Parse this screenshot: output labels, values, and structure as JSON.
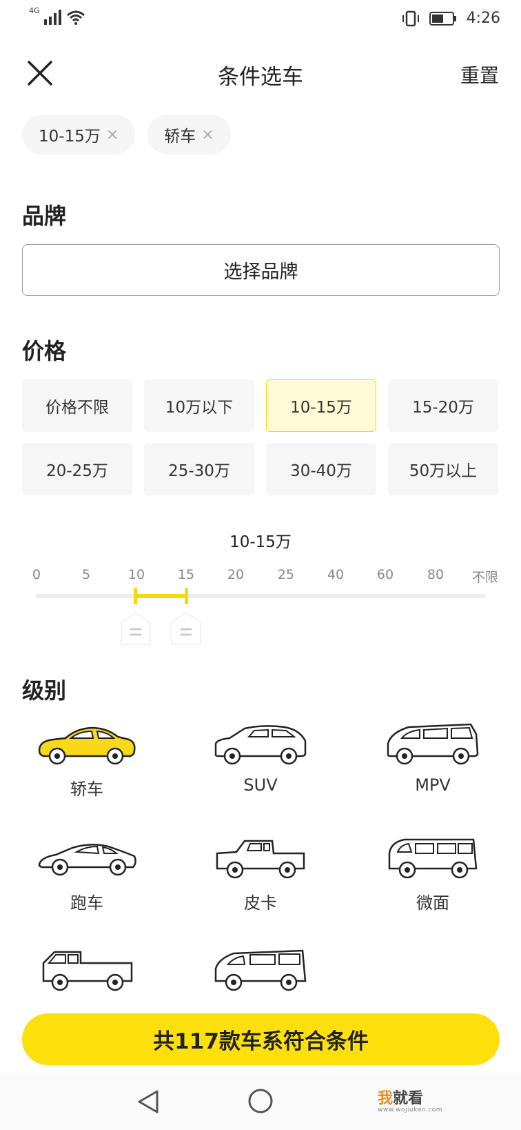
{
  "status_bar": {
    "network": "4G",
    "time": "4:26"
  },
  "header": {
    "title": "条件选车",
    "reset_label": "重置"
  },
  "filter_chips": [
    {
      "label": "10-15万"
    },
    {
      "label": "轿车"
    }
  ],
  "brand": {
    "section_title": "品牌",
    "button_label": "选择品牌"
  },
  "price": {
    "section_title": "价格",
    "options": [
      {
        "label": "价格不限",
        "selected": false
      },
      {
        "label": "10万以下",
        "selected": false
      },
      {
        "label": "10-15万",
        "selected": true
      },
      {
        "label": "15-20万",
        "selected": false
      },
      {
        "label": "20-25万",
        "selected": false
      },
      {
        "label": "25-30万",
        "selected": false
      },
      {
        "label": "30-40万",
        "selected": false
      },
      {
        "label": "50万以上",
        "selected": false
      }
    ],
    "slider": {
      "range_label": "10-15万",
      "ticks": [
        "0",
        "5",
        "10",
        "15",
        "20",
        "25",
        "40",
        "60",
        "80",
        "不限"
      ],
      "selected_min": "10",
      "selected_max": "15",
      "accent_color": "#f5d90a"
    }
  },
  "level": {
    "section_title": "级别",
    "items": [
      {
        "label": "轿车",
        "icon": "sedan-icon",
        "selected": true
      },
      {
        "label": "SUV",
        "icon": "suv-icon",
        "selected": false
      },
      {
        "label": "MPV",
        "icon": "mpv-icon",
        "selected": false
      },
      {
        "label": "跑车",
        "icon": "sports-car-icon",
        "selected": false
      },
      {
        "label": "皮卡",
        "icon": "pickup-icon",
        "selected": false
      },
      {
        "label": "微面",
        "icon": "minivan-icon",
        "selected": false
      },
      {
        "label": "",
        "icon": "light-truck-icon",
        "selected": false
      },
      {
        "label": "",
        "icon": "van-icon",
        "selected": false
      }
    ]
  },
  "cta": {
    "label": "共117款车系符合条件",
    "color": "#fde00b"
  },
  "watermark": {
    "accent": "我",
    "text": "就看",
    "sub": "www.wojiukan.com"
  }
}
